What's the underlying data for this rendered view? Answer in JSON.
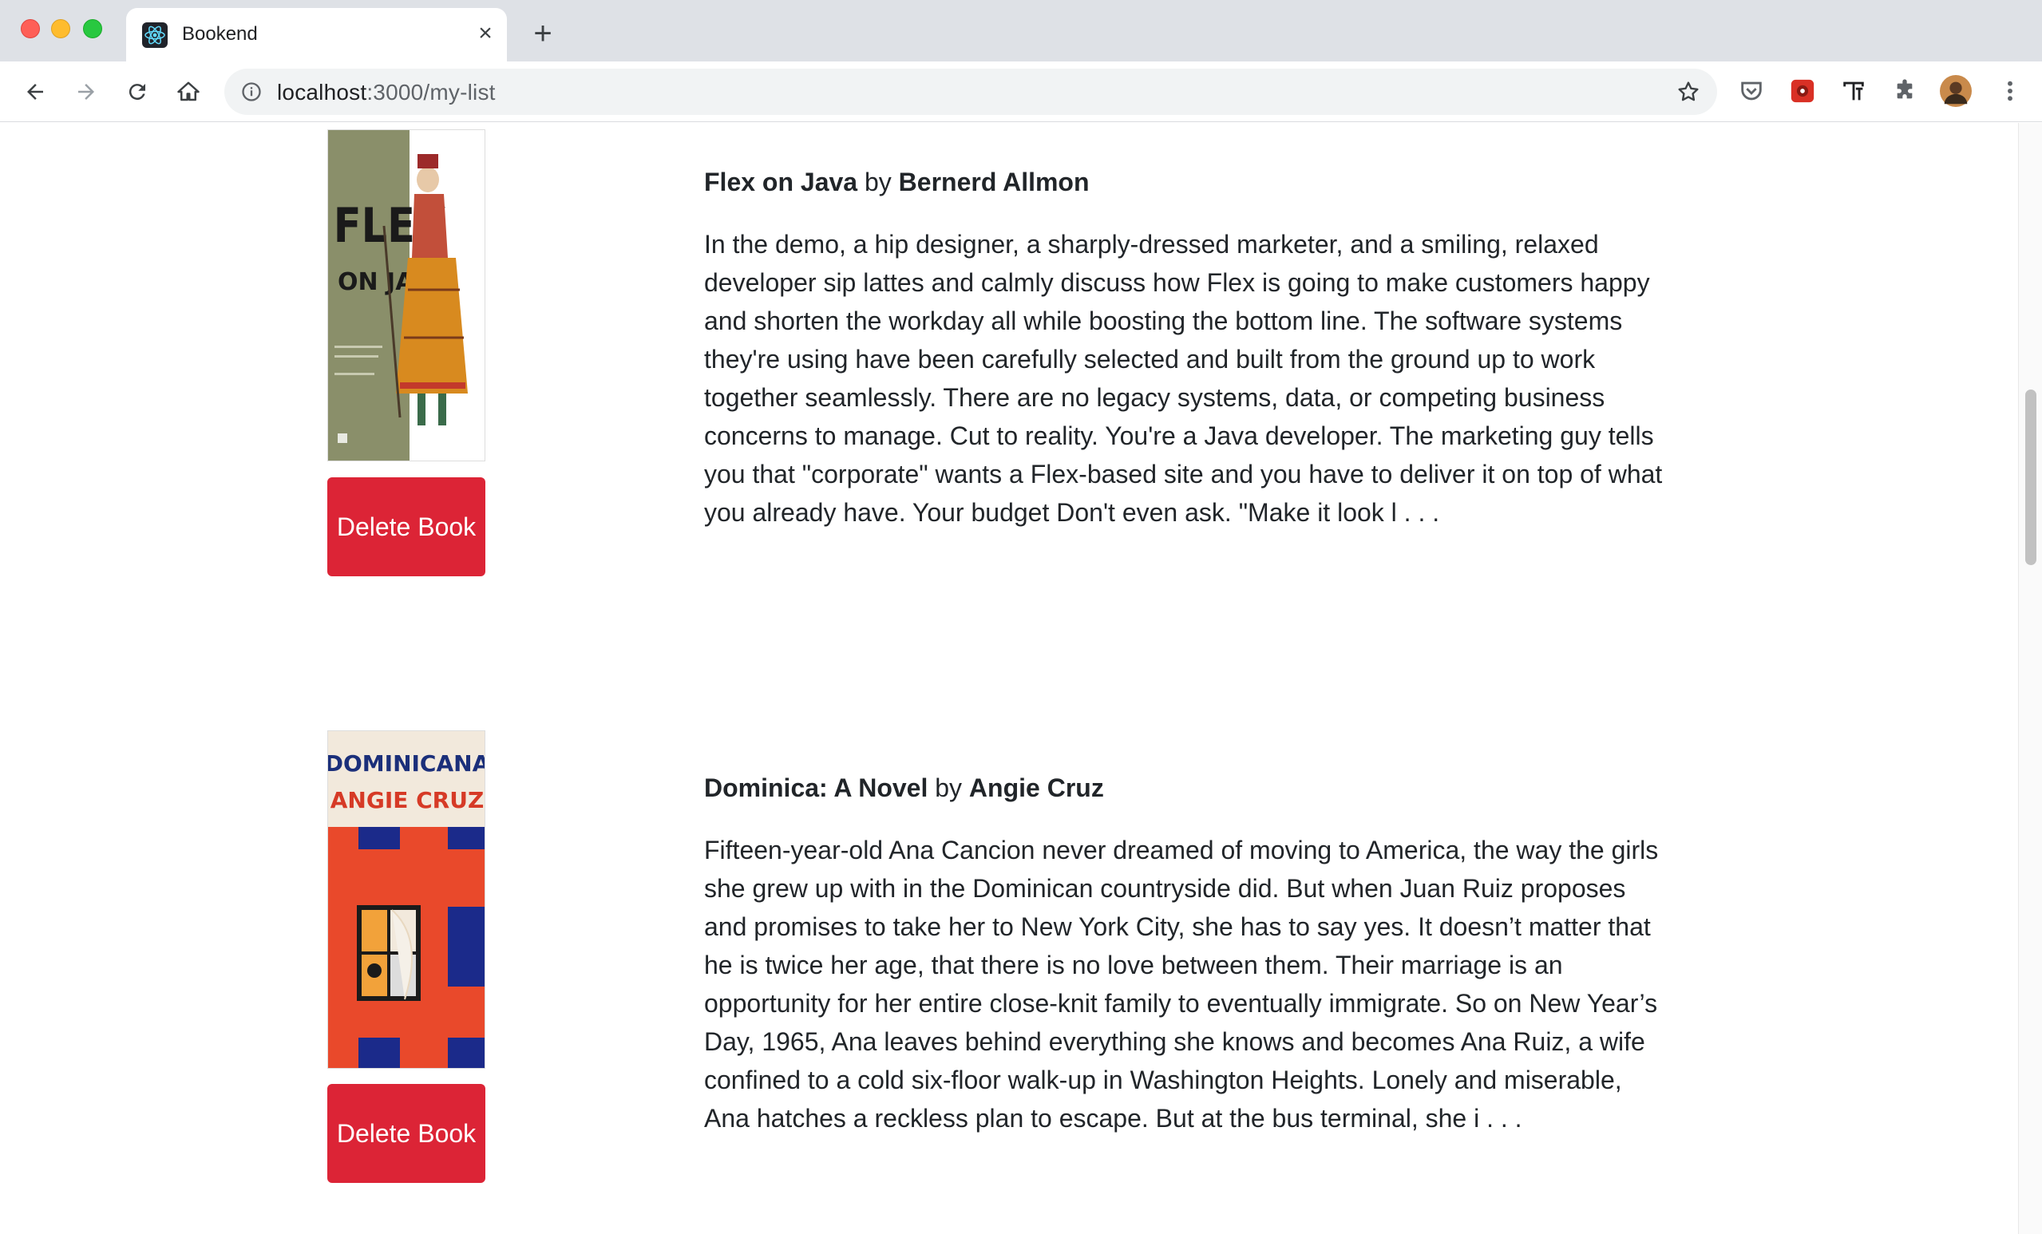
{
  "browser": {
    "tab_title": "Bookend",
    "url_host": "localhost",
    "url_path": ":3000/my-list"
  },
  "books": [
    {
      "title": "Flex on Java",
      "by": "by",
      "author": "Bernerd Allmon",
      "description": "In the demo, a hip designer, a sharply-dressed marketer, and a smiling, relaxed developer sip lattes and calmly discuss how Flex is going to make customers happy and shorten the workday all while boosting the bottom line. The software systems they're using have been carefully selected and built from the ground up to work together seamlessly. There are no legacy systems, data, or competing business concerns to manage. Cut to reality. You're a Java developer. The marketing guy tells you that \"corporate\" wants a Flex-based site and you have to deliver it on top of what you already have. Your budget Don't even ask. \"Make it look l . . .",
      "delete_label": "Delete Book",
      "cover_text": {
        "line1": "FLEX",
        "line2": "ON JAVA"
      }
    },
    {
      "title": "Dominica: A Novel",
      "by": "by",
      "author": "Angie Cruz",
      "description": "Fifteen-year-old Ana Cancion never dreamed of moving to America, the way the girls she grew up with in the Dominican countryside did. But when Juan Ruiz proposes and promises to take her to New York City, she has to say yes. It doesn’t matter that he is twice her age, that there is no love between them. Their marriage is an opportunity for her entire close-knit family to eventually immigrate. So on New Year’s Day, 1965, Ana leaves behind everything she knows and becomes Ana Ruiz, a wife confined to a cold six-floor walk-up in Washington Heights. Lonely and miserable, Ana hatches a reckless plan to escape. But at the bus terminal, she i . . .",
      "delete_label": "Delete Book",
      "cover_text": {
        "line1": "DOMINICANA",
        "line2": "ANGIE CRUZ"
      }
    }
  ],
  "colors": {
    "delete_button": "#dc2436",
    "chrome_bg": "#dee1e6"
  }
}
